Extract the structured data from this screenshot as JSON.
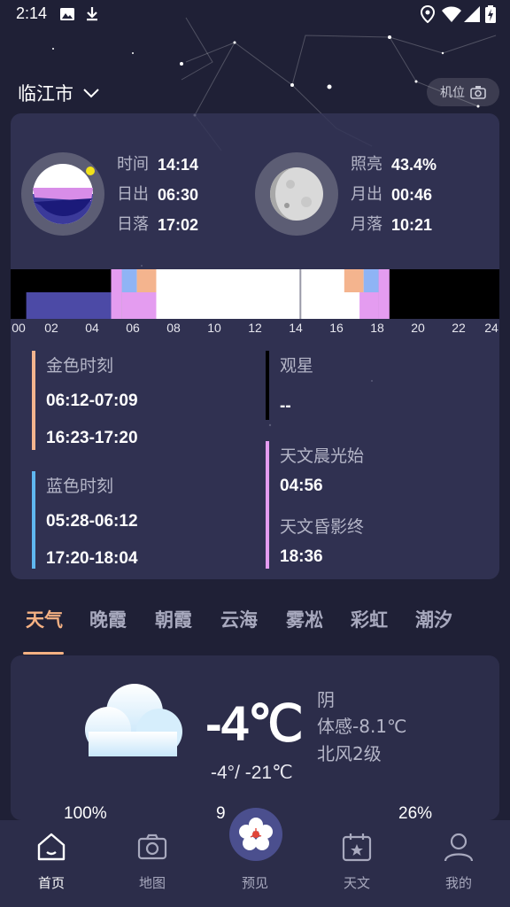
{
  "status_bar": {
    "time": "2:14"
  },
  "header": {
    "city": "临江市",
    "location_button": "机位"
  },
  "sun": {
    "time_label": "时间",
    "time_value": "14:14",
    "rise_label": "日出",
    "rise_value": "06:30",
    "set_label": "日落",
    "set_value": "17:02"
  },
  "moon": {
    "illum_label": "照亮",
    "illum_value": "43.4%",
    "rise_label": "月出",
    "rise_value": "00:46",
    "set_label": "月落",
    "set_value": "10:21"
  },
  "timeline": {
    "hours": [
      "00",
      "02",
      "04",
      "06",
      "08",
      "10",
      "12",
      "14",
      "16",
      "18",
      "20",
      "22",
      "24"
    ],
    "current_hour": 14.23,
    "colors": {
      "night": "#000000",
      "astro": "#4c4aa6",
      "twilight": "#e49cf0",
      "blue": "#8fb4f5",
      "golden": "#f4b48e",
      "day": "#ffffff"
    }
  },
  "periods": {
    "golden": {
      "title": "金色时刻",
      "morning": "06:12-07:09",
      "evening": "16:23-17:20",
      "color": "#f4b48e"
    },
    "blue": {
      "title": "蓝色时刻",
      "morning": "05:28-06:12",
      "evening": "17:20-18:04",
      "color": "#5fb7f0"
    },
    "stargazing": {
      "title": "观星",
      "value": "--",
      "color": "#000000"
    },
    "astro": {
      "dawn_title": "天文晨光始",
      "dawn_value": "04:56",
      "dusk_title": "天文昏影终",
      "dusk_value": "18:36",
      "color": "#e49cf0"
    }
  },
  "tabs": [
    {
      "label": "天气",
      "active": true
    },
    {
      "label": "晚霞",
      "active": false
    },
    {
      "label": "朝霞",
      "active": false
    },
    {
      "label": "云海",
      "active": false
    },
    {
      "label": "雾凇",
      "active": false
    },
    {
      "label": "彩虹",
      "active": false
    },
    {
      "label": "潮汐",
      "active": false
    }
  ],
  "weather": {
    "temp": "-4℃",
    "range": "-4°/ -21℃",
    "condition": "阴",
    "feels_like": "体感-8.1℃",
    "wind": "北风2级",
    "stats_peek": [
      "100%",
      "9",
      "26%"
    ]
  },
  "bottom_nav": [
    {
      "label": "首页",
      "icon": "home-icon",
      "active": true
    },
    {
      "label": "地图",
      "icon": "camera-icon",
      "active": false
    },
    {
      "label": "预见",
      "icon": "flower-icon",
      "active": false
    },
    {
      "label": "天文",
      "icon": "calendar-icon",
      "active": false
    },
    {
      "label": "我的",
      "icon": "user-icon",
      "active": false
    }
  ]
}
